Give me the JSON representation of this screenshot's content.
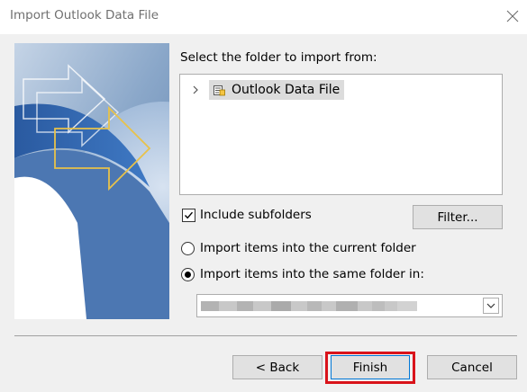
{
  "window": {
    "title": "Import Outlook Data File"
  },
  "icons": {
    "close": "close-icon",
    "expand": "chevron-right-icon",
    "data_file": "pst-data-file-icon",
    "dropdown": "chevron-down-icon"
  },
  "folder_picker": {
    "label": "Select the folder to import from:",
    "tree": [
      {
        "label": "Outlook Data File",
        "expanded": false,
        "selected": true
      }
    ]
  },
  "options": {
    "include_subfolders_label": "Include subfolders",
    "include_subfolders_checked": true,
    "filter_button": "Filter...",
    "radio_current_label": "Import items into the current folder",
    "radio_same_label": "Import items into the same folder in:",
    "selected_radio": "same_folder",
    "target_folder_value": ""
  },
  "buttons": {
    "back": "< Back",
    "finish": "Finish",
    "cancel": "Cancel"
  },
  "colors": {
    "highlight": "#d9131a",
    "focus_border": "#0078d7",
    "dialog_bg": "#f0f0f0"
  }
}
